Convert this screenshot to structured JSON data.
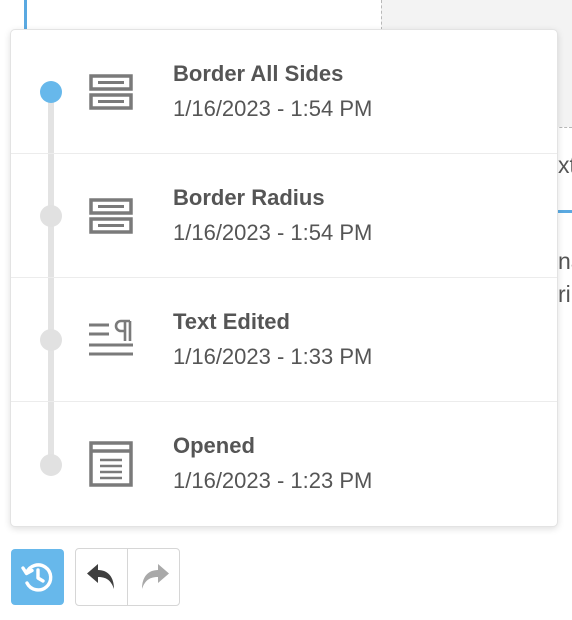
{
  "background": {
    "text_fragments": [
      "xt",
      "na",
      "ri"
    ]
  },
  "history": {
    "items": [
      {
        "title": "Border All Sides",
        "time": "1/16/2023 - 1:54 PM",
        "icon": "border-block-icon",
        "active": true
      },
      {
        "title": "Border Radius",
        "time": "1/16/2023 - 1:54 PM",
        "icon": "border-block-icon",
        "active": false
      },
      {
        "title": "Text Edited",
        "time": "1/16/2023 - 1:33 PM",
        "icon": "paragraph-icon",
        "active": false
      },
      {
        "title": "Opened",
        "time": "1/16/2023 - 1:23 PM",
        "icon": "document-icon",
        "active": false
      }
    ]
  },
  "toolbar": {
    "history_icon": "history-icon",
    "undo_icon": "undo-icon",
    "redo_icon": "redo-icon"
  },
  "colors": {
    "accent": "#67b8eb",
    "inactive_dot": "#e1e1e1",
    "text": "#555555",
    "icon": "#7a7a7a"
  }
}
